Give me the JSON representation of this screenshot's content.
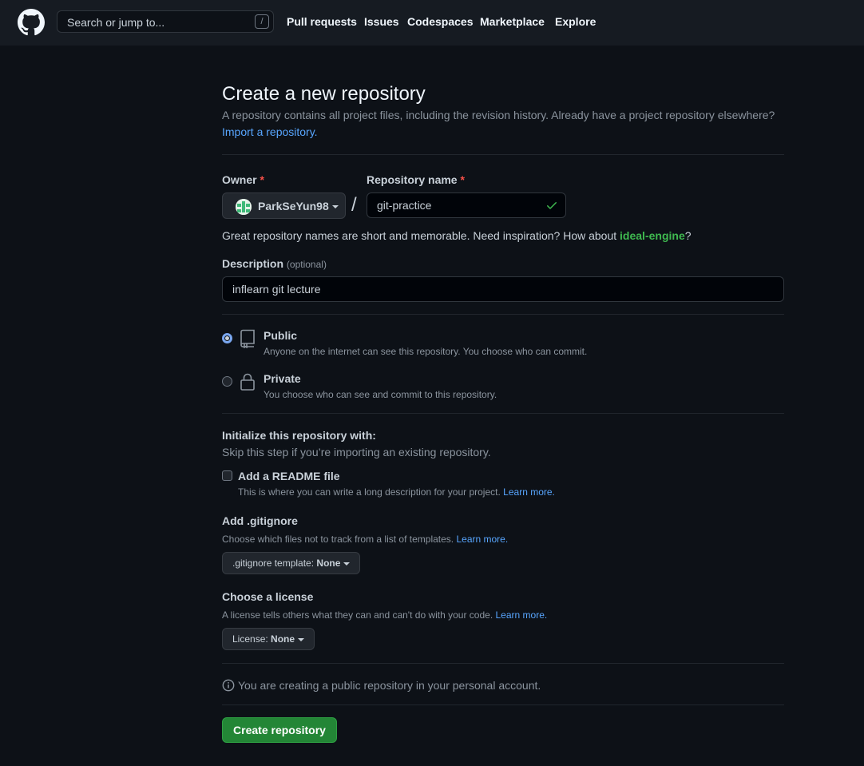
{
  "header": {
    "search_placeholder": "Search or jump to...",
    "search_shortcut": "/",
    "nav": [
      "Pull requests",
      "Issues",
      "Codespaces",
      "Marketplace",
      "Explore"
    ]
  },
  "page": {
    "title": "Create a new repository",
    "subtitle": "A repository contains all project files, including the revision history. Already have a project repository elsewhere?",
    "import_link": "Import a repository."
  },
  "owner": {
    "label": "Owner",
    "required_mark": "*",
    "value": "ParkSeYun98"
  },
  "repo_name": {
    "label": "Repository name",
    "required_mark": "*",
    "separator": "/",
    "value": "git-practice"
  },
  "name_hint": {
    "text": "Great repository names are short and memorable. Need inspiration? How about ",
    "suggestion": "ideal-engine",
    "end": "?"
  },
  "description": {
    "label": "Description",
    "optional": "(optional)",
    "value": "inflearn git lecture"
  },
  "visibility": {
    "selected": "Public",
    "public_title": "Public",
    "public_desc": "Anyone on the internet can see this repository. You choose who can commit.",
    "private_title": "Private",
    "private_desc": "You choose who can see and commit to this repository."
  },
  "init": {
    "title": "Initialize this repository with:",
    "subtitle": "Skip this step if you’re importing an existing repository.",
    "readme_label": "Add a README file",
    "readme_checked": false,
    "readme_desc": "This is where you can write a long description for your project.",
    "learn_more": "Learn more."
  },
  "gitignore": {
    "title": "Add .gitignore",
    "desc": "Choose which files not to track from a list of templates.",
    "learn_more": "Learn more.",
    "button_prefix": ".gitignore template:",
    "button_value": "None"
  },
  "license": {
    "title": "Choose a license",
    "desc": "A license tells others what they can and can't do with your code.",
    "learn_more": "Learn more.",
    "button_prefix": "License:",
    "button_value": "None"
  },
  "notice": "You are creating a public repository in your personal account.",
  "submit_label": "Create repository",
  "colors": {
    "background": "#0d1117",
    "header": "#161b22",
    "link": "#58a6ff",
    "success": "#3fb950",
    "button_green": "#238636",
    "required": "#f85149"
  }
}
